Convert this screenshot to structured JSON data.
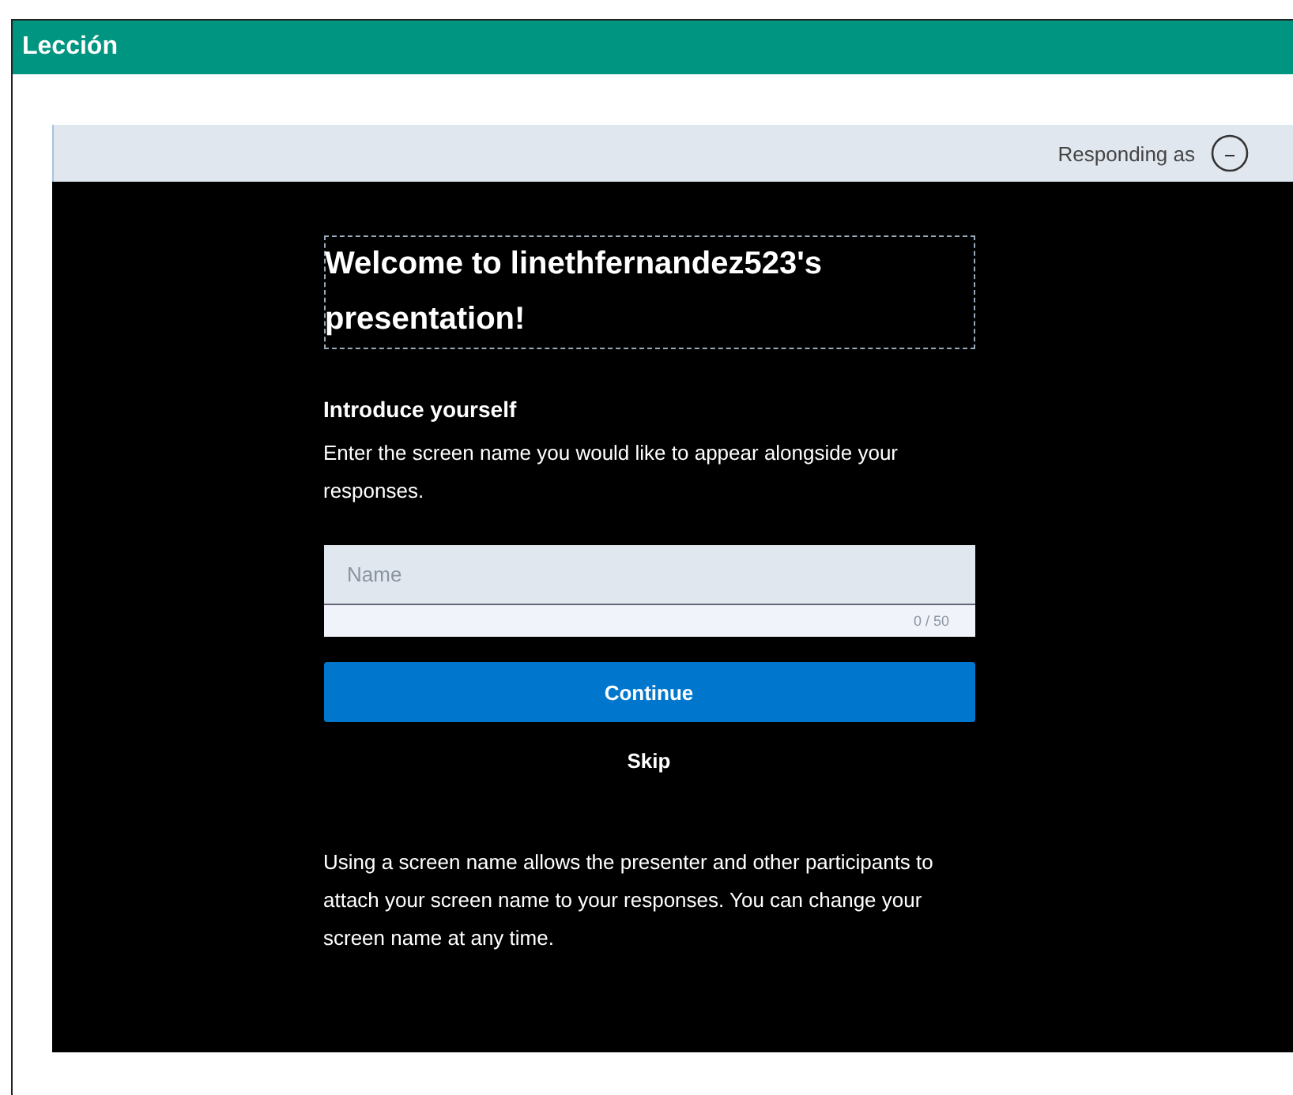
{
  "window": {
    "title": "Lección"
  },
  "header": {
    "label": "Responding as"
  },
  "dialog": {
    "title": "Welcome to linethfernandez523's presentation!",
    "subtitle": "Introduce yourself",
    "instructions": "Enter the screen name you would like to appear alongside your responses.",
    "name_field": {
      "placeholder": "Name",
      "counter": "0 / 50"
    },
    "buttons": [
      {
        "label": "Continue",
        "kind": "primary"
      },
      {
        "label": "Skip",
        "kind": "link"
      }
    ],
    "note": "Using a screen name allows the presenter and other participants to attach your screen name to your responses. You can change your screen name at any time."
  }
}
